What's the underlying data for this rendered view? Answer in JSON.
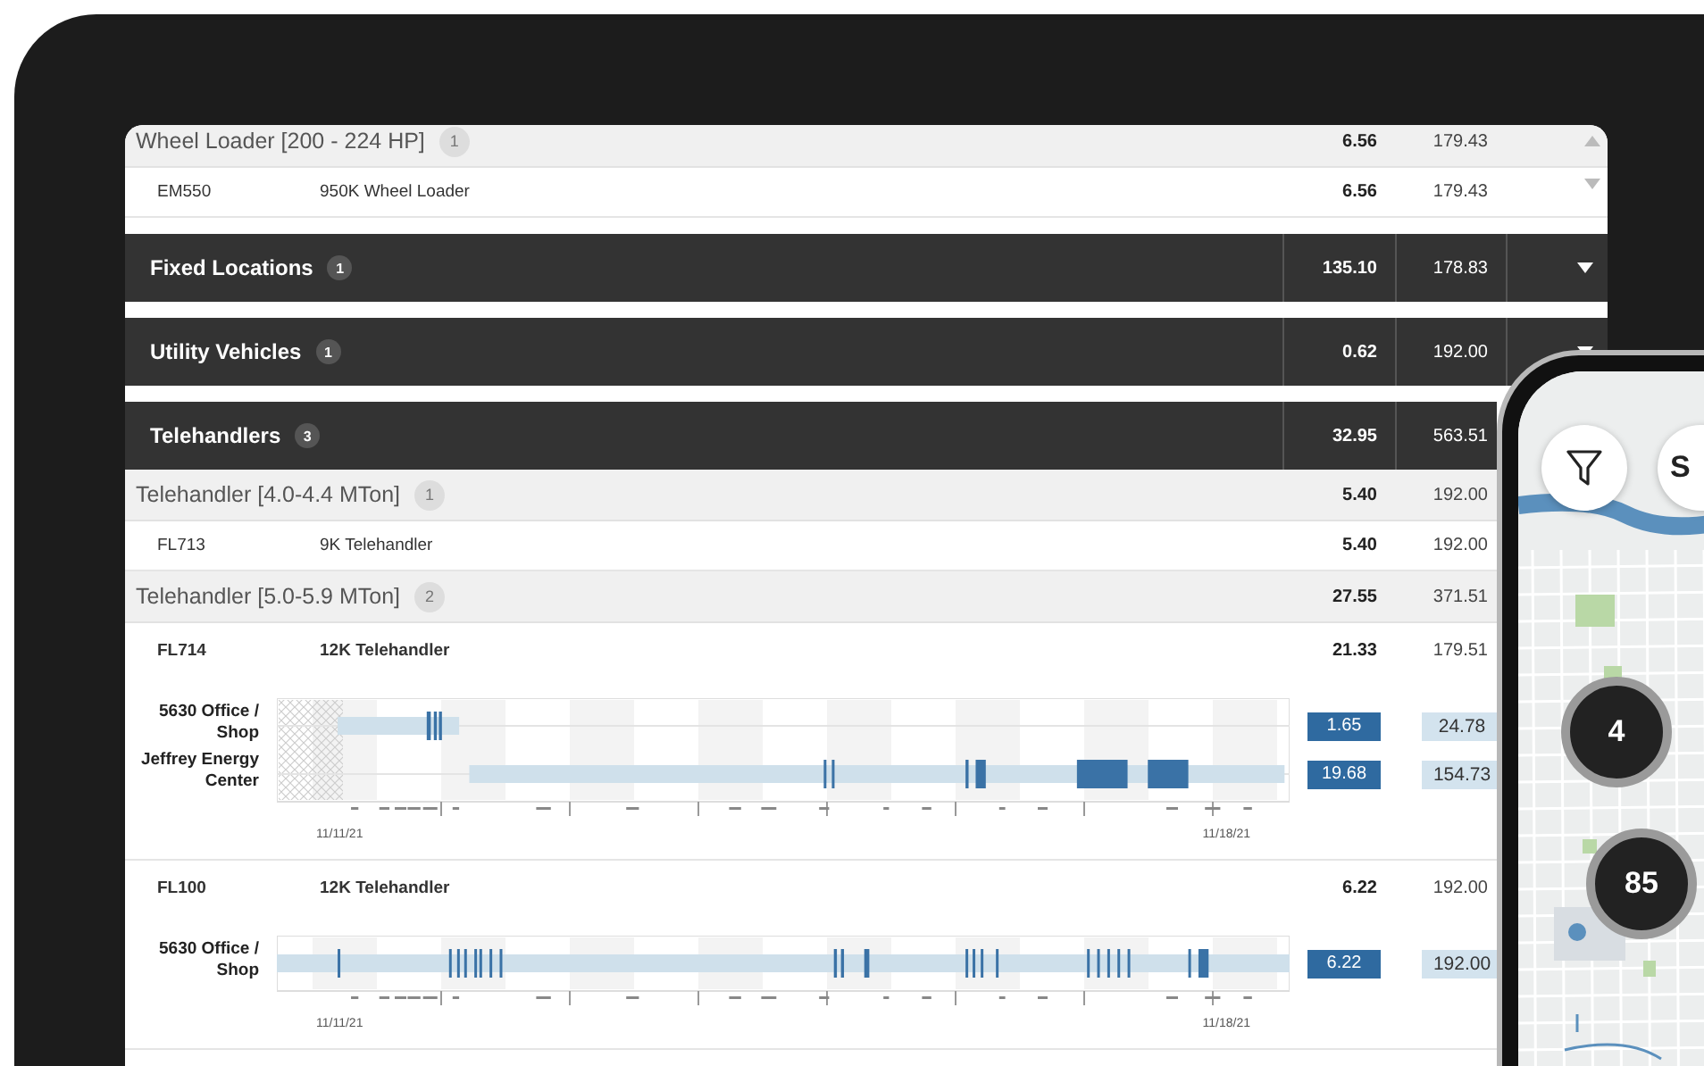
{
  "rows": [
    {
      "kind": "subgroup",
      "name": "Wheel Loader [200 - 224 HP]",
      "count": "1",
      "value": "6.56",
      "total": "179.43"
    },
    {
      "kind": "item",
      "id": "EM550",
      "name": "950K Wheel Loader",
      "value": "6.56",
      "total": "179.43"
    },
    {
      "kind": "group",
      "name": "Fixed Locations",
      "count": "1",
      "value": "135.10",
      "total": "178.83"
    },
    {
      "kind": "group",
      "name": "Utility Vehicles",
      "count": "1",
      "value": "0.62",
      "total": "192.00"
    },
    {
      "kind": "group",
      "name": "Telehandlers",
      "count": "3",
      "value": "32.95",
      "total": "563.51"
    },
    {
      "kind": "subgroup",
      "name": "Telehandler [4.0-4.4 MTon]",
      "count": "1",
      "value": "5.40",
      "total": "192.00"
    },
    {
      "kind": "item",
      "id": "FL713",
      "name": "9K Telehandler",
      "value": "5.40",
      "total": "192.00"
    },
    {
      "kind": "subgroup",
      "name": "Telehandler [5.0-5.9 MTon]",
      "count": "2",
      "value": "27.55",
      "total": "371.51"
    },
    {
      "kind": "detail",
      "id": "FL714",
      "name": "12K Telehandler",
      "value": "21.33",
      "total": "179.51",
      "locations": [
        {
          "name": "5630 Office / Shop",
          "value": "1.65",
          "total": "24.78"
        },
        {
          "name": "Jeffrey Energy Center",
          "value": "19.68",
          "total": "154.73"
        }
      ],
      "dates": [
        "11/11/21",
        "11/18/21"
      ]
    },
    {
      "kind": "detail",
      "id": "FL100",
      "name": "12K Telehandler",
      "value": "6.22",
      "total": "192.00",
      "locations": [
        {
          "name": "5630 Office / Shop",
          "value": "6.22",
          "total": "192.00"
        }
      ],
      "dates": [
        "11/11/21",
        "11/18/21"
      ]
    }
  ],
  "phone": {
    "search_button": "S",
    "clusters": [
      "4",
      "85"
    ]
  }
}
